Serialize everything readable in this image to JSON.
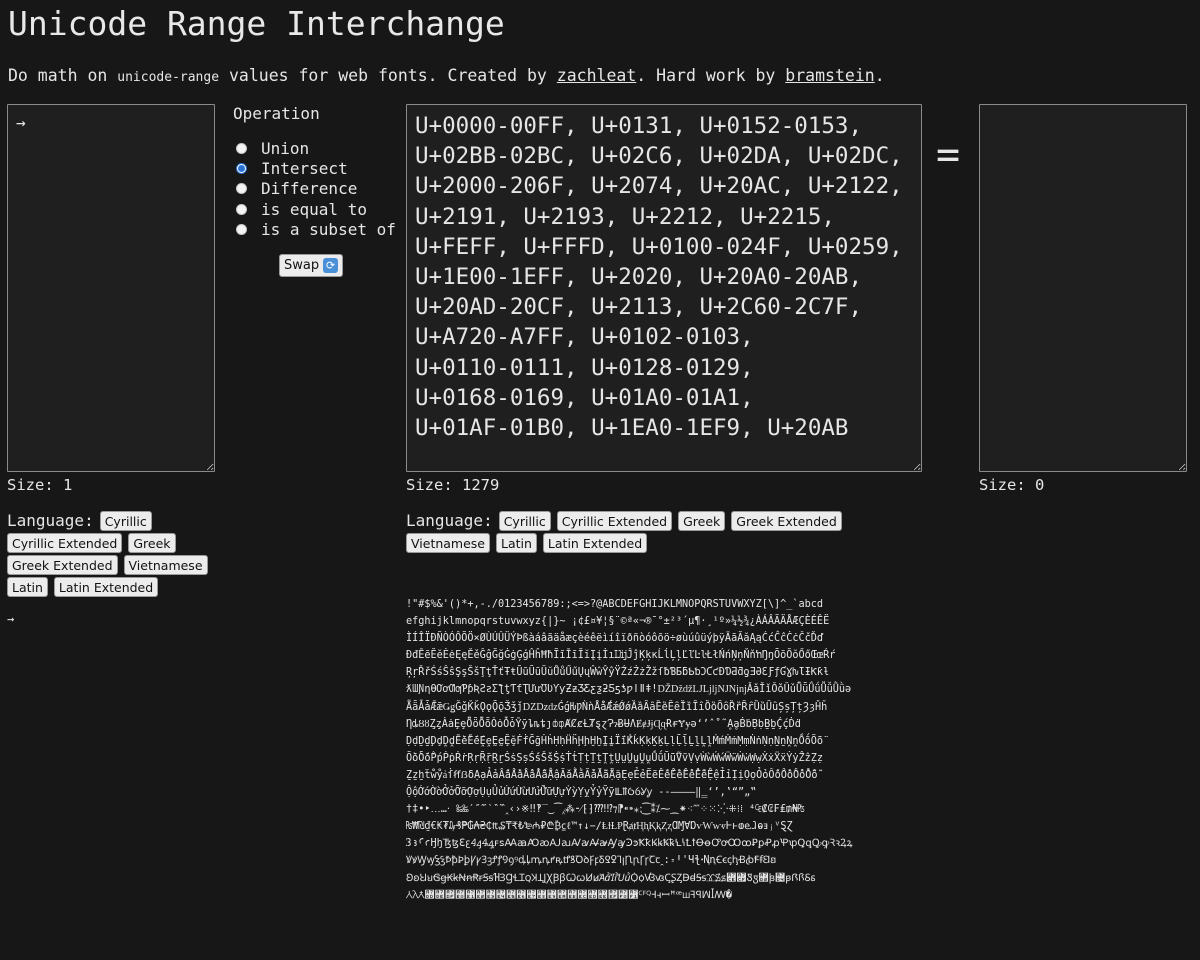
{
  "title": "Unicode Range Interchange",
  "intro": {
    "prefix": "Do math on ",
    "code": "unicode-range",
    "middle": " values for web fonts. Created by ",
    "author_link": "zachleat",
    "middle2": ". Hard work by ",
    "credit_link": "bramstein",
    "suffix": "."
  },
  "left_input": {
    "value": "→"
  },
  "middle_input": {
    "value": "U+0000-00FF, U+0131, U+0152-0153,\nU+02BB-02BC, U+02C6, U+02DA, U+02DC,\nU+2000-206F, U+2074, U+20AC, U+2122,\nU+2191, U+2193, U+2212, U+2215,\nU+FEFF, U+FFFD, U+0100-024F, U+0259,\nU+1E00-1EFF, U+2020, U+20A0-20AB,\nU+20AD-20CF, U+2113, U+2C60-2C7F,\nU+A720-A7FF, U+0102-0103,\nU+0110-0111, U+0128-0129,\nU+0168-0169, U+01A0-01A1,\nU+01AF-01B0, U+1EA0-1EF9, U+20AB"
  },
  "result_input": {
    "value": ""
  },
  "operation": {
    "title": "Operation",
    "options": [
      {
        "label": "Union",
        "selected": false
      },
      {
        "label": "Intersect",
        "selected": true
      },
      {
        "label": "Difference",
        "selected": false
      },
      {
        "label": "is equal to",
        "selected": false
      },
      {
        "label": "is a subset of",
        "selected": false
      }
    ],
    "swap_label": "Swap"
  },
  "equals_symbol": "=",
  "sizes": {
    "left": "Size: 1",
    "middle": "Size: 1279",
    "result": "Size: 0"
  },
  "language_label": "Language:",
  "left_languages": [
    "Cyrillic",
    "Cyrillic Extended",
    "Greek",
    "Greek Extended",
    "Vietnamese",
    "Latin",
    "Latin Extended"
  ],
  "middle_languages": [
    "Cyrillic",
    "Cyrillic Extended",
    "Greek",
    "Greek Extended",
    "Vietnamese",
    "Latin",
    "Latin Extended"
  ],
  "left_preview": "→",
  "preview_lines": [
    " !\"#$%&'()*+,-./0123456789:;<=>?@ABCDEFGHIJKLMNOPQRSTUVWXYZ[\\]^_`abcd",
    "efghijklmnopqrstuvwxyz{|}~ ¡¢£¤¥¦§¨©ª«¬­®¯°±²³´µ¶·¸¹º»¼½¾¿ÀÁÂÃÄÅÆÇÈÉÊË",
    "ÌÍÎÏÐÑÒÓÔÕÖ×ØÙÚÛÜÝÞßàáâãäåæçèéêëìíîïðñòóôõö÷øùúûüýþÿĀāĂăĄąĆćĈĉĊċČčĎď",
    "ĐđĒēĔĕĖėĘęĚěĜĝĞğĠġĢģĤĥĦħĨĩĪīĬĭĮįİıĲĳĴĵĶķĸĹĺĻļĽľĿŀŁłŃńŅņŇňŉŊŋŌōŎŏŐőŒœŔŕ",
    "ŖŗŘřŚśŜŝŞşŠšŢţŤťŦŧŨũŪūŬŭŮůŰűŲųŴŵŶŷŸŹźŻżŽžſƀƁƂƃƄƅƆƇƈƉƊƋƌƍƎƏƐƑƒƓƔƕƖƗƘƙƚ",
    "ƛƜƝƞƟƠơƢƣƤƥƦƧƨƩƪƫƬƭƮƯưƱƲƳƴƵƶƷƸƹƺƻƼƽƾƿǀǁǂǃǄǅǆǇǈǉǊǋǌǍǎǏǐǑǒǓǔǕǖǗǘǙǚǛǜǝ",
    "ǞǟǠǡǢǣǤǥǦǧǨǩǪǫǬǭǮǯǰǱǲǳǴǵǶǷǸǹǺǻǼǽǾǿȀȁȂȃȄȅȆȇȈȉȊȋȌȍȎȏȐȑȒȓȔȕȖȗȘșȚțȜȝȞȟ",
    "ȠȡȢȣȤȥȦȧȨȩȪȫȬȭȮȯȰȱȲȳȴȵȶȷȸȹȺȻȼȽȾȿɀɁɂɃɄɅɆɇɈɉɊɋɌɍɎɏəʻʼˆ˚˜ḀḁḂḃḄḅḆḇḈḉḊḋ",
    "ḌḍḎḏḐḑḒḓḔḕḖḗḘḙḚḛḜḝḞḟḠḡḢḣḤḥḦḧḨḩḪḫḬḭḮḯḰḱḲḳḴḵḶḷḸḹḺḻḼḽḾḿṀṁṂṃṄṅṆṇṈṉṊṋṌṍṎṏ",
    "ṐṑṒṓṔṕṖṗṘṙṚṛṜṝṞṟṠṡṢṣṤṥṦṧṨṩṪṫṬṭṮṯṰṱṲṳṴṵṶṷṸṹṺṻṼṽṾṿẀẁẂẃẄẅẆẇẈẉẊẋẌẍẎẏẐẑẒẓ",
    "ẔẕẖẗẘẙẚẛẜẝẞẟẠạẢảẤấẦầẨẩẪẫẬậẮắẰằẲẳẴẵẶặẸẹẺẻẼẽẾếỀềỂểỄễỆệỈỉỊịỌọỎỏỐốỒồỔổỖỗ",
    "ỘộỚớỜờỞởỠỡỢợỤụỦủỨứỪừỬửỮữỰựỲỳỴỵỶỷỸỹỺỻỼỽỾỿ           ​‌‍‎‏‐‑‒–—―‖‗‘’‚‛“”„‟",
    "†‡•‣․‥…‧    ‰‱′″‴‵‶‷‸‹›※‼‽‾‿⁀⁁⁂⁃⁄⁅⁆⁇⁈⁉⁊⁋⁌⁍⁎⁏⁐⁑⁒⁓⁔⁕⁖⁗⁘⁙⁚⁛⁜⁝⁞ ⁴₠₡₢₣₤₥₦₧",
    "₨₩₪₫€₭₮₯₰₱₲₳₴₵₶₷₸₹₺₻₼₽₾₿⃀ℓ™↑↓−∕ⱠⱡⱢⱣⱤⱥⱦⱧⱨⱩⱪⱫⱬⱭⱮⱯⱰⱱⱲⱳⱴⱵⱶⱷⱸⱹⱺⱻⱼⱽⱾⱿ",
    "꜠꜡ꜢꜣꜤꜥꜦꜧꜨꜩꜪꜫꜬꜭꜮꜯꜰꜱꜲꜳꜴꜵꜶꜷꜸꜹꜺꜻꜼꜽꜾꜿꝀꝁꝂꝃꝄꝅꝆꝇꝈꝉꝊꝋꝌꝍꝎꝏꝐꝑꝒꝓꝔꝕꝖꝗꝘꝙꝚꝛꝜꝝ",
    "ꝞꝟꝠꝡꝢꝣꝤꝥꝦꝧꝨꝩꝪꝫꝬꝭꝮꝯꝰꝱꝲꝳꝴꝵꝶꝷꝸꝹꝺꝻꝼꝽꝾꝿꞀꞁꞂꞃꞄꞅꞆꞇꞈ꞉꞊ꞋꞌꞍꞎꞏꞐꞑꞒꞓꞔꞕꞖꞗꞘꞙꞚꞛ",
    "ꞜꞝꞞꞟꞠꞡꞢꞣꞤꞥꞦꞧꞨꞩꞪꞫꞬꞭꞮꞯꞰꞱꞲꞳꞴꞵꞶꞷꞸꞹꞺꞻꞼꞽꞾꞿꟀꟁꟂꟃꟄꟅꟆꟇꟈꟉꟊꟋꟌꟍ꟎꟏Ꟑꟑ꟒ꟓ꟔ꟕꟖꟗꟘꟙ",
    "ꟚꟛꟜ꟝꟞꟟꟠꟡꟢꟣꟤꟥꟦꟧꟨꟩꟪꟫꟬꟭꟮꟯꟰꟱ꟲꟳꟴꟵꟶꟷꟸꟹꟺꟻꟼꟽꟾꟿ﻿�"
  ]
}
